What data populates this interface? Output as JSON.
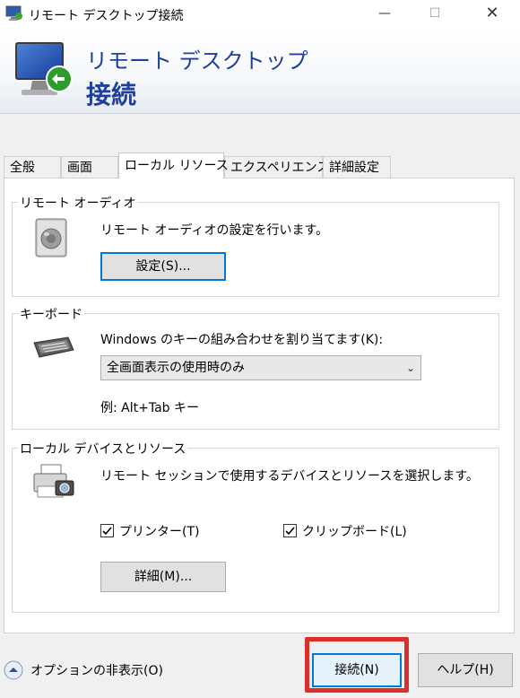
{
  "window": {
    "title": "リモート デスクトップ接続",
    "minimize_glyph": "—",
    "maximize_glyph": "☐",
    "close_glyph": "✕"
  },
  "header": {
    "line1": "リモート デスクトップ",
    "line2": "接続",
    "icon": "remote-desktop-icon"
  },
  "tabs": [
    {
      "label": "全般",
      "active": false
    },
    {
      "label": "画面",
      "active": false
    },
    {
      "label": "ローカル リソース",
      "active": true
    },
    {
      "label": "エクスペリエンス",
      "active": false
    },
    {
      "label": "詳細設定",
      "active": false
    }
  ],
  "audio": {
    "group_label": "リモート オーディオ",
    "description": "リモート オーディオの設定を行います。",
    "settings_button": "設定(S)...",
    "icon": "speaker-icon"
  },
  "keyboard": {
    "group_label": "キーボード",
    "description": "Windows のキーの組み合わせを割り当てます(K):",
    "select_value": "全画面表示の使用時のみ",
    "example": "例: Alt+Tab キー",
    "icon": "keyboard-icon"
  },
  "devices": {
    "group_label": "ローカル デバイスとリソース",
    "description": "リモート セッションで使用するデバイスとリソースを選択します。",
    "printer_label": "プリンター(T)",
    "printer_checked": true,
    "clipboard_label": "クリップボード(L)",
    "clipboard_checked": true,
    "details_button": "詳細(M)...",
    "icon": "printer-camera-icon"
  },
  "footer": {
    "options_label": "オプションの非表示(O)",
    "connect_button": "接続(N)",
    "help_button": "ヘルプ(H)",
    "highlight_color": "#d9302c",
    "accent_color": "#0078d7"
  }
}
